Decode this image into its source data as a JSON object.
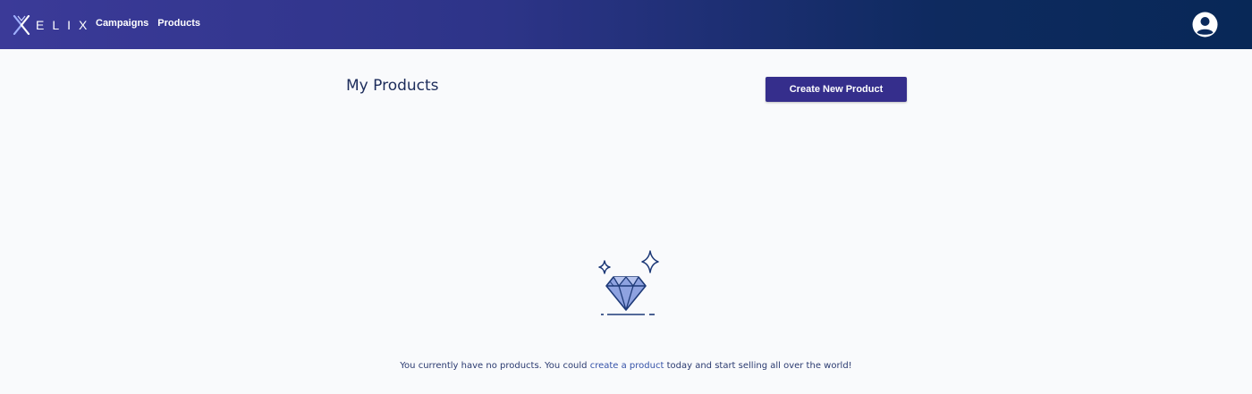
{
  "header": {
    "logo_text": "ELIX",
    "nav": [
      {
        "label": "Campaigns"
      },
      {
        "label": "Products"
      }
    ],
    "avatar_icon": "user-circle-icon"
  },
  "main": {
    "title": "My Products",
    "create_button_label": "Create New Product",
    "empty_state": {
      "illustration_icon": "diamond-sparkle-icon",
      "message_before": "You currently have no products. You could ",
      "message_link": "create a product",
      "message_after": " today and start selling all over the world!"
    }
  },
  "colors": {
    "header_gradient_start": "#3b3a98",
    "header_gradient_end": "#082857",
    "button_bg": "#352e8c",
    "title_color": "#1c2c5b",
    "page_bg": "#f9fafc"
  }
}
